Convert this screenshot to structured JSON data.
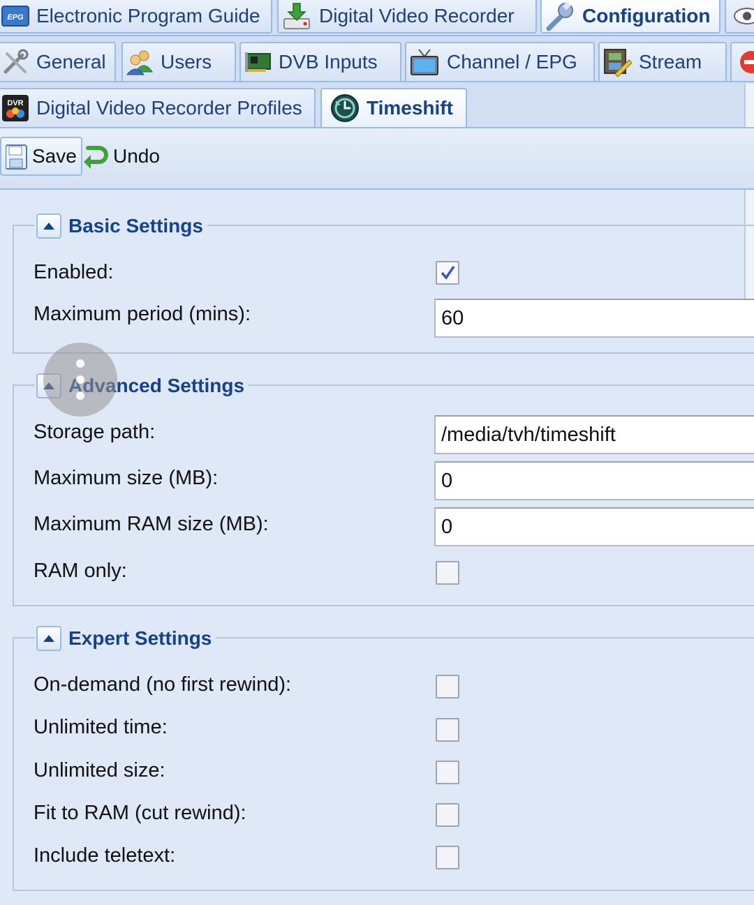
{
  "tabs_main": [
    {
      "label": "Electronic Program Guide",
      "icon": "epg-icon",
      "active": false
    },
    {
      "label": "Digital Video Recorder",
      "icon": "dvr-download-icon",
      "active": false
    },
    {
      "label": "Configuration",
      "icon": "wrench-icon",
      "active": true
    }
  ],
  "tabs_config": [
    {
      "label": "General",
      "icon": "tools-icon"
    },
    {
      "label": "Users",
      "icon": "users-icon"
    },
    {
      "label": "DVB Inputs",
      "icon": "tuner-card-icon"
    },
    {
      "label": "Channel / EPG",
      "icon": "tv-icon"
    },
    {
      "label": "Stream",
      "icon": "film-edit-icon"
    }
  ],
  "tabs_recording": [
    {
      "label": "Digital Video Recorder Profiles",
      "icon": "dvr-profiles-icon",
      "active": false
    },
    {
      "label": "Timeshift",
      "icon": "timeshift-clock-icon",
      "active": true
    }
  ],
  "toolbar": {
    "save_label": "Save",
    "undo_label": "Undo"
  },
  "basic": {
    "title": "Basic Settings",
    "enabled_label": "Enabled:",
    "enabled": true,
    "max_period_label": "Maximum period (mins):",
    "max_period_value": "60"
  },
  "advanced": {
    "title": "Advanced Settings",
    "storage_path_label": "Storage path:",
    "storage_path_value": "/media/tvh/timeshift",
    "max_size_label": "Maximum size (MB):",
    "max_size_value": "0",
    "max_ram_label": "Maximum RAM size (MB):",
    "max_ram_value": "0",
    "ram_only_label": "RAM only:",
    "ram_only": false
  },
  "expert": {
    "title": "Expert Settings",
    "on_demand_label": "On-demand (no first rewind):",
    "on_demand": false,
    "unlimited_time_label": "Unlimited time:",
    "unlimited_time": false,
    "unlimited_size_label": "Unlimited size:",
    "unlimited_size": false,
    "fit_to_ram_label": "Fit to RAM (cut rewind):",
    "fit_to_ram": false,
    "include_teletext_label": "Include teletext:",
    "include_teletext": false
  },
  "colors": {
    "accent": "#15428b",
    "panel_bg": "#dfe8f6",
    "border": "#99bbe8"
  }
}
